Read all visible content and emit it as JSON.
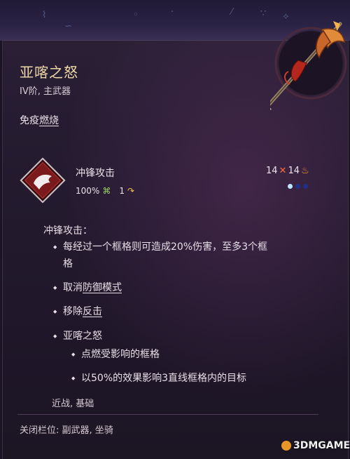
{
  "item": {
    "name": "亚喀之怒",
    "subtitle": "IV阶, 主武器",
    "immune_prefix": "免疫",
    "immune_status": "燃烧"
  },
  "action": {
    "name": "冲锋攻击",
    "accuracy": "100%",
    "ap_cost": "1",
    "dmg_min": "14",
    "dmg_max": "14"
  },
  "description": {
    "heading": "冲锋攻击：",
    "bullet1_line1": "每经过一个框格则可造成20%伤害，至多3个框",
    "bullet1_line2": "格",
    "bullet2_prefix": "取消",
    "bullet2_link": "防御模式",
    "bullet3_prefix": "移除",
    "bullet3_link": "反击",
    "bullet4": "亚喀之怒",
    "sub1": "点燃受影响的框格",
    "sub2": "以50%的效果影响3直线框格内的目标"
  },
  "tags": "近战, 基础",
  "slots": "关闭栏位:  副武器, 坐骑",
  "watermark": "3DMGAME"
}
